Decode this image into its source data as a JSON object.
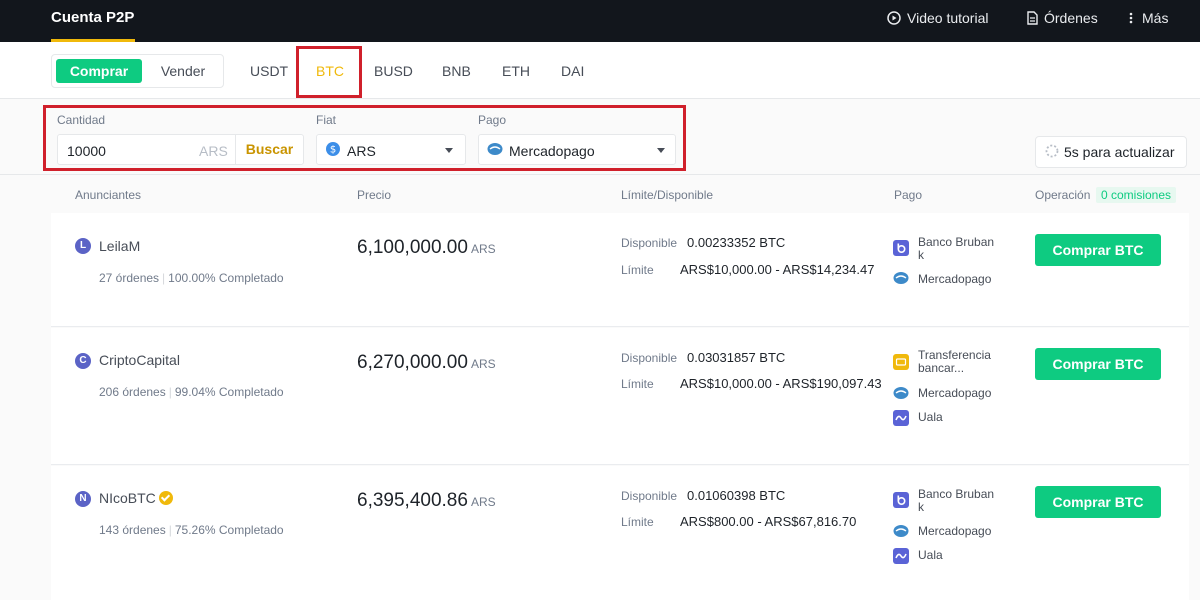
{
  "header": {
    "brand": "Cuenta P2P",
    "video_tutorial": "Video tutorial",
    "orders": "Órdenes",
    "more": "Más"
  },
  "trade_toggle": {
    "buy": "Comprar",
    "sell": "Vender"
  },
  "assets": [
    "USDT",
    "BTC",
    "BUSD",
    "BNB",
    "ETH",
    "DAI"
  ],
  "selected_asset": "BTC",
  "filters": {
    "amount_label": "Cantidad",
    "amount_value": "10000",
    "amount_unit": "ARS",
    "search_button": "Buscar",
    "fiat_label": "Fiat",
    "fiat_value": "ARS",
    "payment_label": "Pago",
    "payment_value": "Mercadopago",
    "refresh": "5s para actualizar"
  },
  "table": {
    "columns": [
      "Anunciantes",
      "Precio",
      "Límite/Disponible",
      "Pago",
      "Operación"
    ],
    "fee_badge": "0 comisiones",
    "available_label": "Disponible",
    "limit_label": "Límite",
    "rows": [
      {
        "avatar": "L",
        "name": "LeilaM",
        "orders": "27 órdenes",
        "completion": "100.00% Completado",
        "price": "6,100,000.00",
        "currency": "ARS",
        "available": "0.00233352 BTC",
        "limit": "ARS$10,000.00 - ARS$14,234.47",
        "payments": [
          "Banco Bruban k",
          "Mercadopago"
        ],
        "button": "Comprar BTC"
      },
      {
        "avatar": "C",
        "name": "CriptoCapital",
        "orders": "206 órdenes",
        "completion": "99.04% Completado",
        "price": "6,270,000.00",
        "currency": "ARS",
        "available": "0.03031857 BTC",
        "limit": "ARS$10,000.00 - ARS$190,097.43",
        "payments": [
          "Transferencia bancar...",
          "Mercadopago",
          "Uala"
        ],
        "button": "Comprar BTC"
      },
      {
        "avatar": "N",
        "name": "NIcoBTC",
        "orders": "143 órdenes",
        "completion": "75.26% Completado",
        "price": "6,395,400.86",
        "currency": "ARS",
        "available": "0.01060398 BTC",
        "limit": "ARS$800.00 - ARS$67,816.70",
        "payments": [
          "Banco Bruban k",
          "Mercadopago",
          "Uala"
        ],
        "button": "Comprar BTC"
      }
    ]
  },
  "colors": {
    "topbar": "#12161c",
    "accent_yellow": "#f0b90b",
    "buy_green": "#0ecb81",
    "highlight_red": "#d0202b"
  }
}
